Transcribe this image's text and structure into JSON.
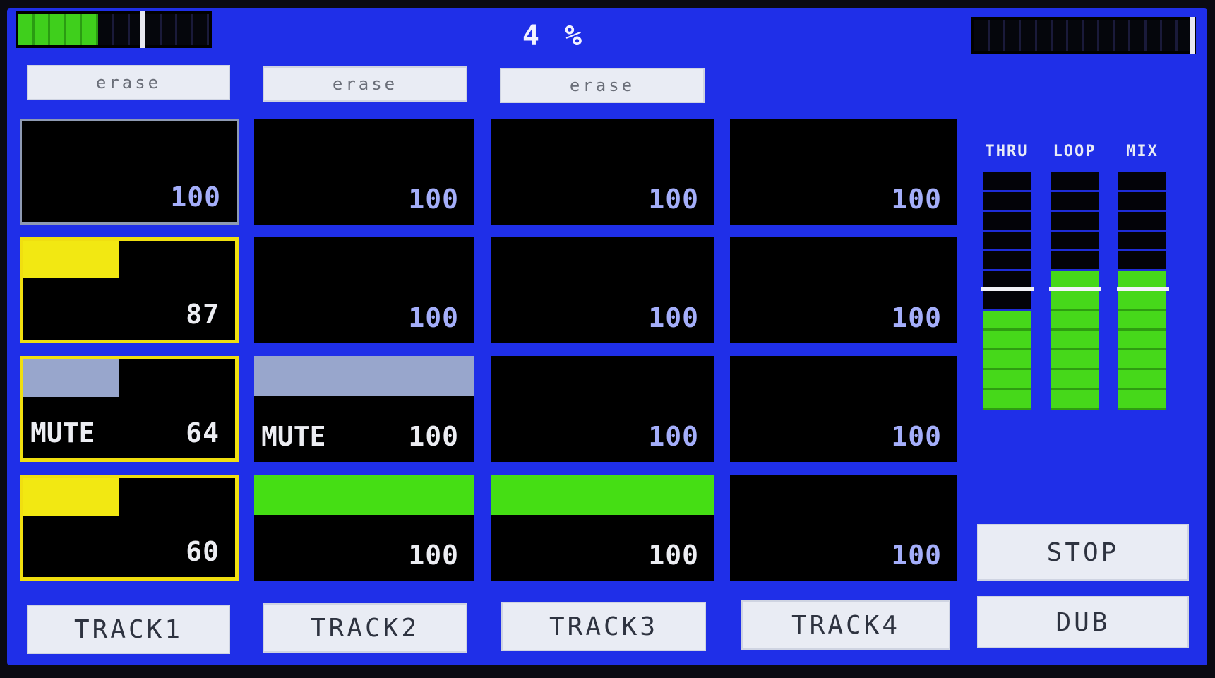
{
  "header": {
    "left_meter": {
      "segments": 12,
      "lit": 5,
      "marker_segment": 8
    },
    "progress_label": "4 %",
    "right_meter": {
      "segments": 14,
      "lit": 0,
      "marker_segment": 14
    }
  },
  "erase_buttons": [
    "erase",
    "erase",
    "erase"
  ],
  "pads": [
    [
      {
        "value": "100",
        "mute": "",
        "bar": "none",
        "bar_fraction": 0,
        "style": "selected-gray"
      },
      {
        "value": "87",
        "mute": "",
        "bar": "yellow",
        "bar_fraction": 0.45,
        "style": "selected-yellow"
      },
      {
        "value": "64",
        "mute": "MUTE",
        "bar": "gray",
        "bar_fraction": 0.45,
        "style": "selected-yellow"
      },
      {
        "value": "60",
        "mute": "",
        "bar": "yellow",
        "bar_fraction": 0.45,
        "style": "selected-yellow"
      }
    ],
    [
      {
        "value": "100",
        "mute": "",
        "bar": "none",
        "bar_fraction": 0,
        "style": "normal"
      },
      {
        "value": "100",
        "mute": "",
        "bar": "none",
        "bar_fraction": 0,
        "style": "normal"
      },
      {
        "value": "100",
        "mute": "MUTE",
        "bar": "gray",
        "bar_fraction": 1.0,
        "style": "normal"
      },
      {
        "value": "100",
        "mute": "",
        "bar": "green",
        "bar_fraction": 1.0,
        "style": "normal"
      }
    ],
    [
      {
        "value": "100",
        "mute": "",
        "bar": "none",
        "bar_fraction": 0,
        "style": "normal"
      },
      {
        "value": "100",
        "mute": "",
        "bar": "none",
        "bar_fraction": 0,
        "style": "normal"
      },
      {
        "value": "100",
        "mute": "",
        "bar": "none",
        "bar_fraction": 0,
        "style": "normal"
      },
      {
        "value": "100",
        "mute": "",
        "bar": "green",
        "bar_fraction": 1.0,
        "style": "normal"
      }
    ],
    [
      {
        "value": "100",
        "mute": "",
        "bar": "none",
        "bar_fraction": 0,
        "style": "normal"
      },
      {
        "value": "100",
        "mute": "",
        "bar": "none",
        "bar_fraction": 0,
        "style": "normal"
      },
      {
        "value": "100",
        "mute": "",
        "bar": "none",
        "bar_fraction": 0,
        "style": "normal"
      },
      {
        "value": "100",
        "mute": "",
        "bar": "none",
        "bar_fraction": 0,
        "style": "normal"
      }
    ]
  ],
  "track_buttons": [
    "TRACK1",
    "TRACK2",
    "TRACK3",
    "TRACK4"
  ],
  "level_meters": [
    {
      "label": "THRU",
      "segments": 12,
      "lit": 5,
      "peak_segment": 6
    },
    {
      "label": "LOOP",
      "segments": 12,
      "lit": 7,
      "peak_segment": 6
    },
    {
      "label": "MIX",
      "segments": 12,
      "lit": 7,
      "peak_segment": 6
    }
  ],
  "transport": {
    "stop_label": "STOP",
    "dub_label": "DUB"
  },
  "colors": {
    "background": "#1f2fe8",
    "pad_bg": "#000000",
    "selected_border": "#f0df10",
    "level_green": "#46d81a",
    "value_blue": "#a4aefa"
  }
}
